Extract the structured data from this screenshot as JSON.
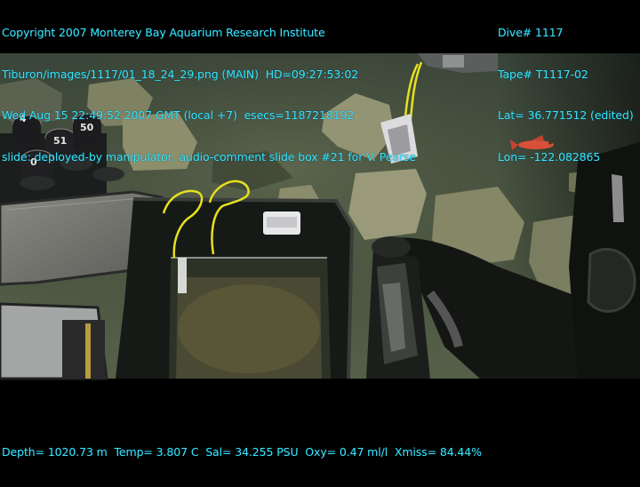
{
  "overlay": {
    "left_lines": [
      "Copyright 2007 Monterey Bay Aquarium Research Institute",
      "Tiburon/images/1117/01_18_24_29.png (MAIN)  HD=09:27:53:02",
      "Wed Aug 15 22:49:52 2007 GMT (local +7)  esecs=1187218192",
      "slide: deployed-by manipulator, audio-comment slide box #21 for V. Pearse"
    ],
    "right_lines": [
      "Dive# 1117",
      "Tape# T1117-02",
      "Lat= 36.771512 (edited)",
      "Lon= -122.082865"
    ],
    "bottom_line": "Depth= 1020.73 m  Temp= 3.807 C  Sal= 34.255 PSU  Oxy= 0.47 ml/l  Xmiss= 84.44%"
  },
  "scene": {
    "tube_labels": [
      "4",
      "51",
      "50",
      "0"
    ],
    "colors": {
      "overlay_text": "#36e6ff",
      "seafloor": "#4e5a44",
      "water": "#3e4a3c",
      "rock": "#8a8c6a",
      "cord": "#e8e020",
      "fish": "#e0503a"
    }
  }
}
